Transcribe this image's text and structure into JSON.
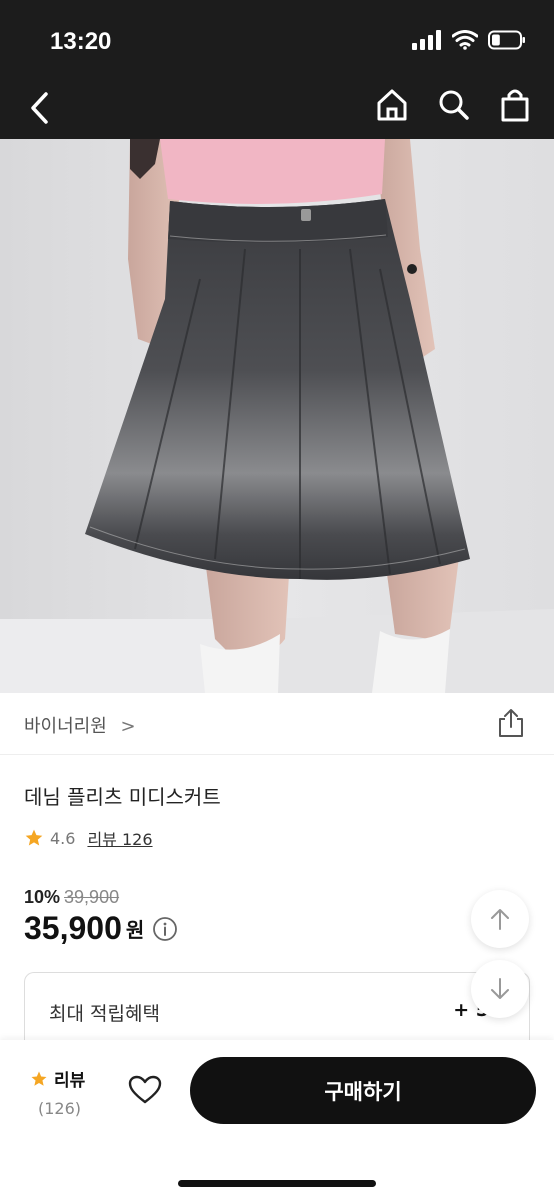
{
  "status_bar": {
    "time": "13:20",
    "battery_level": 0.3
  },
  "nav": {
    "icons": [
      "back-icon",
      "home-icon",
      "search-icon",
      "shopping-bag-icon"
    ]
  },
  "product": {
    "seller": "바이너리원",
    "seller_chevron": ">",
    "title": "데님 플리츠 미디스커트",
    "rating": "4.6",
    "review_label": "리뷰 126",
    "discount": "10%",
    "original_price": "39,900",
    "sale_price": "35,900",
    "currency": "원"
  },
  "benefit": {
    "label": "최대 적립혜택",
    "value": "+ 5"
  },
  "bottom_bar": {
    "review_label": "리뷰",
    "review_count": "(126)",
    "buy_label": "구매하기"
  },
  "colors": {
    "star": "#F5A623",
    "buy_button": "#111111",
    "top_bar": "#1C1C1C"
  }
}
